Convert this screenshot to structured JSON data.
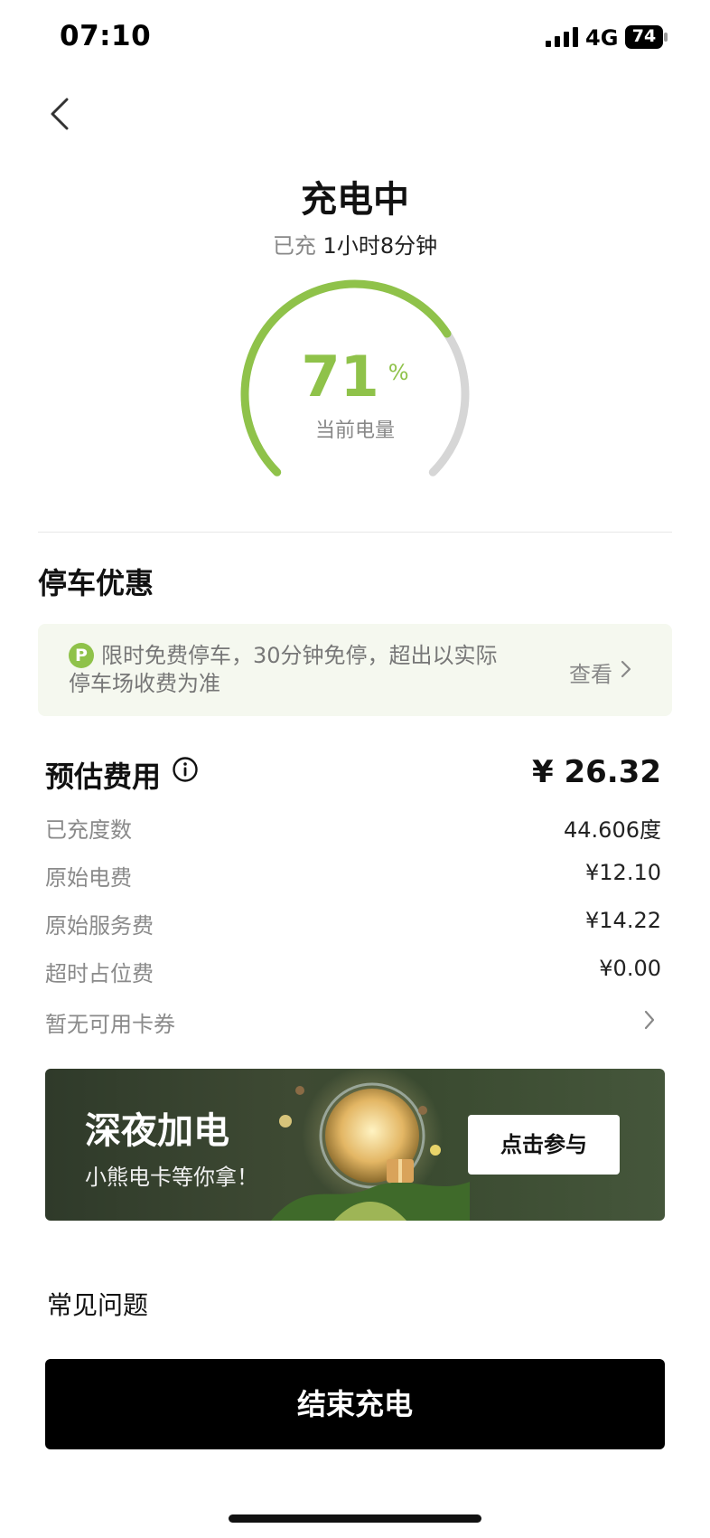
{
  "status_bar": {
    "time": "07:10",
    "network": "4G",
    "battery": "74"
  },
  "header": {
    "title": "充电中",
    "duration_prefix": "已充",
    "duration_value": "1小时8分钟"
  },
  "gauge": {
    "percent": "71",
    "unit": "%",
    "label": "当前电量",
    "fill_fraction": 0.71
  },
  "parking": {
    "title": "停车优惠",
    "icon_letter": "P",
    "text": "限时免费停车，30分钟免停，超出以实际停车场收费为准",
    "view_label": "查看"
  },
  "fees": {
    "title": "预估费用",
    "total": "¥ 26.32",
    "rows": [
      {
        "label": "已充度数",
        "value": "44.606度"
      },
      {
        "label": "原始电费",
        "value": "¥12.10"
      },
      {
        "label": "原始服务费",
        "value": "¥14.22"
      },
      {
        "label": "超时占位费",
        "value": "¥0.00"
      }
    ],
    "coupon_label": "暂无可用卡券"
  },
  "banner": {
    "title": "深夜加电",
    "subtitle": "小熊电卡等你拿！",
    "button_label": "点击参与"
  },
  "faq_label": "常见问题",
  "end_button_label": "结束充电",
  "colors": {
    "accent_green": "#8fc24a",
    "track_gray": "#d6d6d6",
    "button_black": "#000000"
  }
}
